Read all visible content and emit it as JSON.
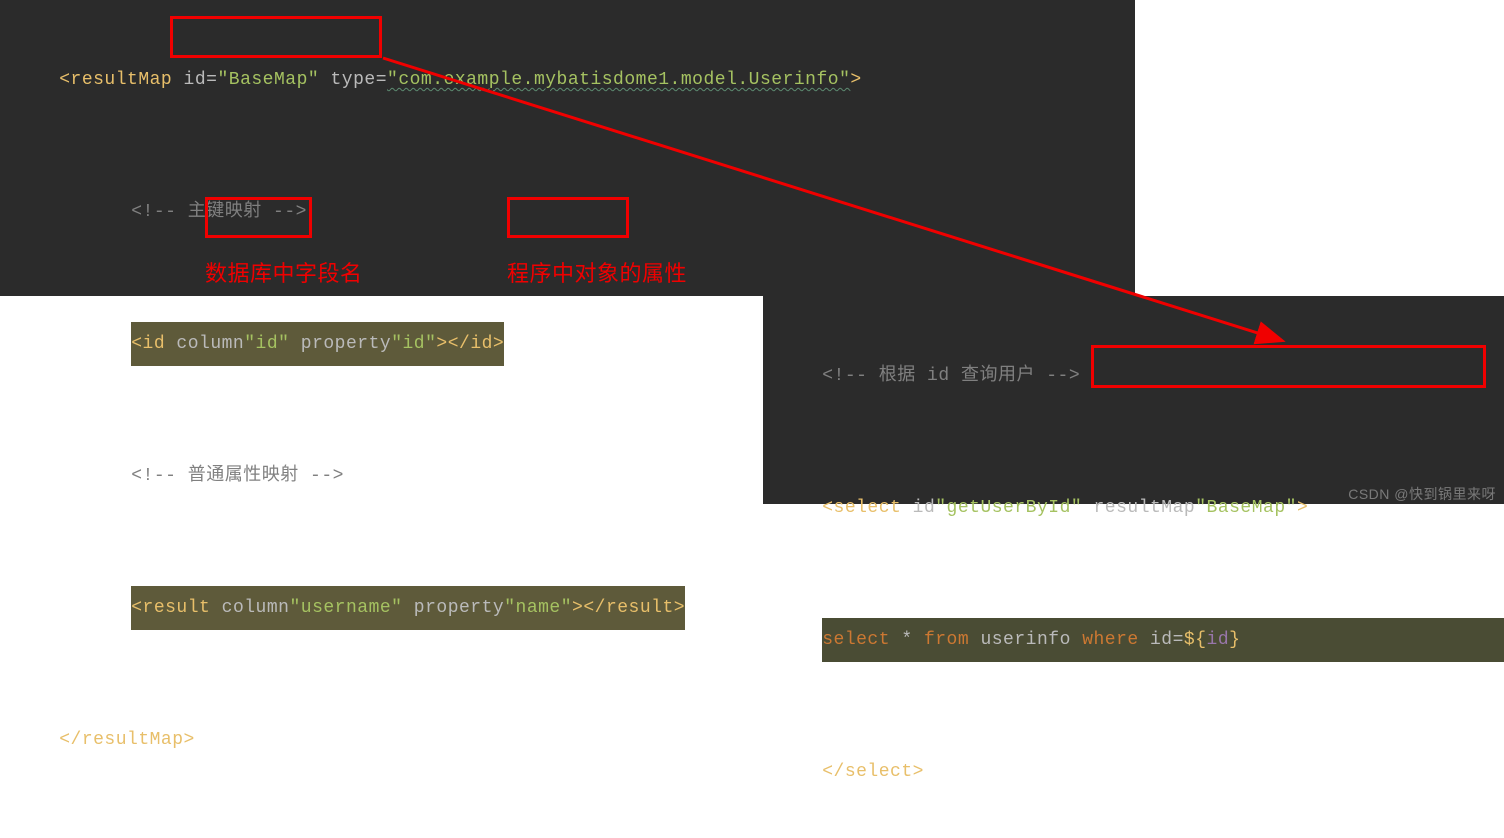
{
  "top": {
    "line1": {
      "tag_open": "<resultMap",
      "attr_id": " id",
      "eq": "=",
      "val_id": "\"BaseMap\"",
      "attr_type": " type",
      "val_type": "\"com.example.mybatisdome1.model.Userinfo\"",
      "tag_close": ">"
    },
    "line2": {
      "comment_open": "<!-- ",
      "comment_text": "主键映射 ",
      "comment_close": "-->"
    },
    "line3": {
      "tag_open": "<id",
      "attr_col": " column",
      "val_col": "\"id\"",
      "attr_prop": " property",
      "val_prop": "\"id\"",
      "tag_mid": ">",
      "tag_close": "</id>"
    },
    "line4": {
      "comment_open": "<!-- ",
      "comment_text": "普通属性映射 ",
      "comment_close": "-->"
    },
    "line5": {
      "tag_open": "<result",
      "attr_col": " column",
      "val_col": "\"username\"",
      "attr_prop": " property",
      "val_prop": "\"name\"",
      "tag_mid": ">",
      "tag_close": "</result>"
    },
    "line6": {
      "tag_close": "</resultMap>"
    }
  },
  "bottom": {
    "line1": {
      "comment_open": "<!-- ",
      "comment_text": "根据 id 查询用户 ",
      "comment_close": "-->"
    },
    "line2": {
      "tag_open": "<select",
      "attr_id": " id",
      "val_id": "\"getUserById\"",
      "attr_rm": " resultMap",
      "val_rm": "\"BaseMap\"",
      "tag_close": ">"
    },
    "line3": {
      "sql1": "select",
      "star": " * ",
      "sql2": "from",
      "table": " userinfo ",
      "sql3": "where",
      "col": " id",
      "eq": "=",
      "dollar": "$",
      "brace_l": "{",
      "var": "id",
      "brace_r": "}"
    },
    "line4": {
      "tag_close": "</select>"
    }
  },
  "annotations": {
    "db_field": "数据库中字段名",
    "obj_prop": "程序中对象的属性"
  },
  "watermark": "CSDN @快到锅里来呀"
}
